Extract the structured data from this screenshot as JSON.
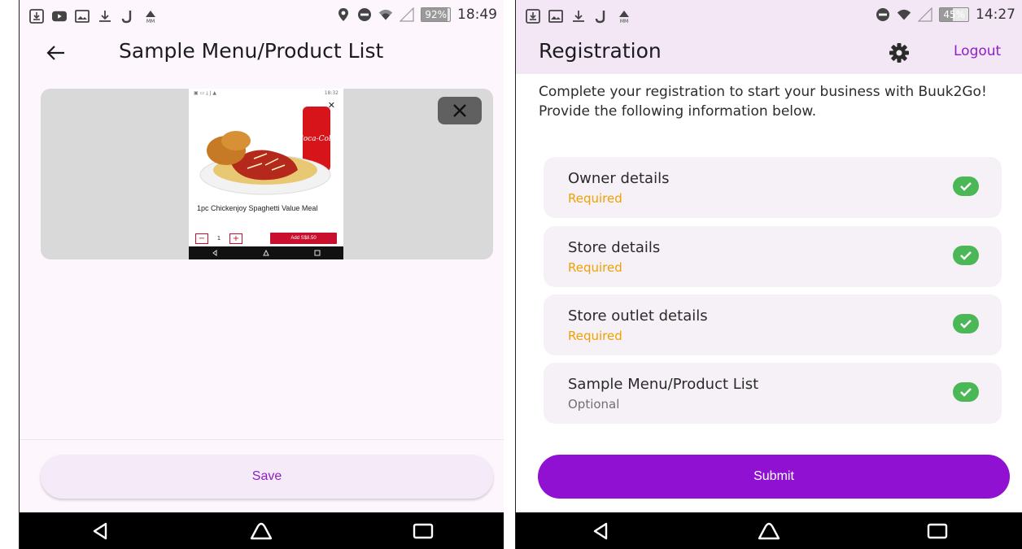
{
  "left": {
    "status": {
      "battery": "92%",
      "battery_level": 0.92,
      "time": "18:49"
    },
    "header": {
      "title": "Sample Menu/Product List"
    },
    "preview": {
      "mini_time": "18:32",
      "product_name": "1pc Chickenjoy Spaghetti Value Meal",
      "quantity": "1",
      "add_button": "Add S$8.50",
      "can_label": "Coca-Cola"
    },
    "footer": {
      "save_label": "Save"
    }
  },
  "right": {
    "status": {
      "battery": "45%",
      "battery_level": 0.45,
      "time": "14:27"
    },
    "header": {
      "title": "Registration",
      "logout_label": "Logout"
    },
    "intro": "Complete your registration to start your business with Buuk2Go! Provide the following information below.",
    "sections": [
      {
        "title": "Owner details",
        "status": "Required",
        "status_kind": "required"
      },
      {
        "title": "Store details",
        "status": "Required",
        "status_kind": "required"
      },
      {
        "title": "Store outlet details",
        "status": "Required",
        "status_kind": "required"
      },
      {
        "title": "Sample Menu/Product List",
        "status": "Optional",
        "status_kind": "optional"
      }
    ],
    "footer": {
      "submit_label": "Submit"
    }
  },
  "colors": {
    "accent": "#8e1fc7",
    "submit_bg": "#9011d1",
    "required": "#f0a000",
    "check": "#4bb756",
    "header_bg": "#f3e7f6"
  },
  "icons": [
    "back-arrow-icon",
    "close-icon",
    "gear-icon",
    "check-icon",
    "nav-back-icon",
    "nav-home-icon",
    "nav-recents-icon"
  ]
}
